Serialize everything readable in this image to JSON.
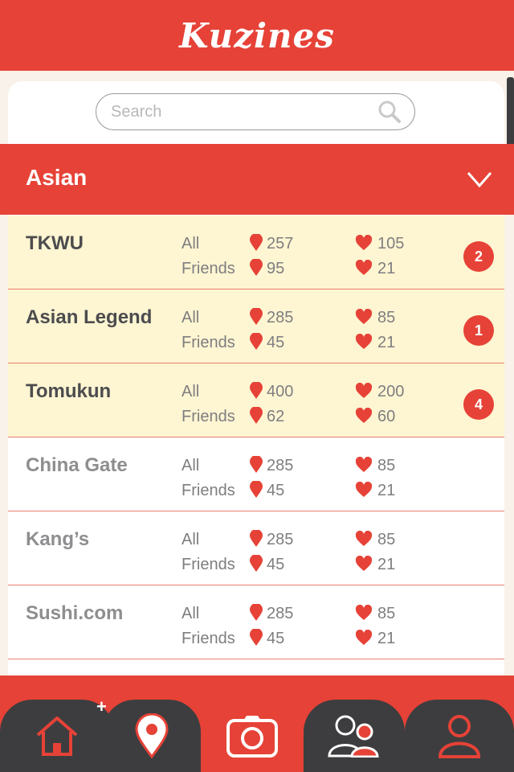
{
  "app": {
    "title": "Kuzines"
  },
  "search": {
    "placeholder": "Search"
  },
  "category": {
    "label": "Asian"
  },
  "list_labels": {
    "all": "All",
    "friends": "Friends"
  },
  "restaurants": [
    {
      "name": "TKWU",
      "all_checkins": "257",
      "all_likes": "105",
      "friends_checkins": "95",
      "friends_likes": "21",
      "badge": "2",
      "highlighted": true
    },
    {
      "name": "Asian Legend",
      "all_checkins": "285",
      "all_likes": "85",
      "friends_checkins": "45",
      "friends_likes": "21",
      "badge": "1",
      "highlighted": true
    },
    {
      "name": "Tomukun",
      "all_checkins": "400",
      "all_likes": "200",
      "friends_checkins": "62",
      "friends_likes": "60",
      "badge": "4",
      "highlighted": true
    },
    {
      "name": "China Gate",
      "all_checkins": "285",
      "all_likes": "85",
      "friends_checkins": "45",
      "friends_likes": "21",
      "badge": "",
      "highlighted": false
    },
    {
      "name": "Kang’s",
      "all_checkins": "285",
      "all_likes": "85",
      "friends_checkins": "45",
      "friends_likes": "21",
      "badge": "",
      "highlighted": false
    },
    {
      "name": "Sushi.com",
      "all_checkins": "285",
      "all_likes": "85",
      "friends_checkins": "45",
      "friends_likes": "21",
      "badge": "",
      "highlighted": false
    }
  ],
  "nav": {
    "plus_label": "+",
    "items": [
      "home-icon",
      "map-pin-icon",
      "camera-icon",
      "friends-icon",
      "profile-icon"
    ]
  },
  "colors": {
    "brand": "#e64237",
    "highlight_row": "#fef5d2",
    "nav_tab": "#3d3d3f",
    "text_dark": "#4c4c4e",
    "text_dim": "#8e8e90"
  }
}
